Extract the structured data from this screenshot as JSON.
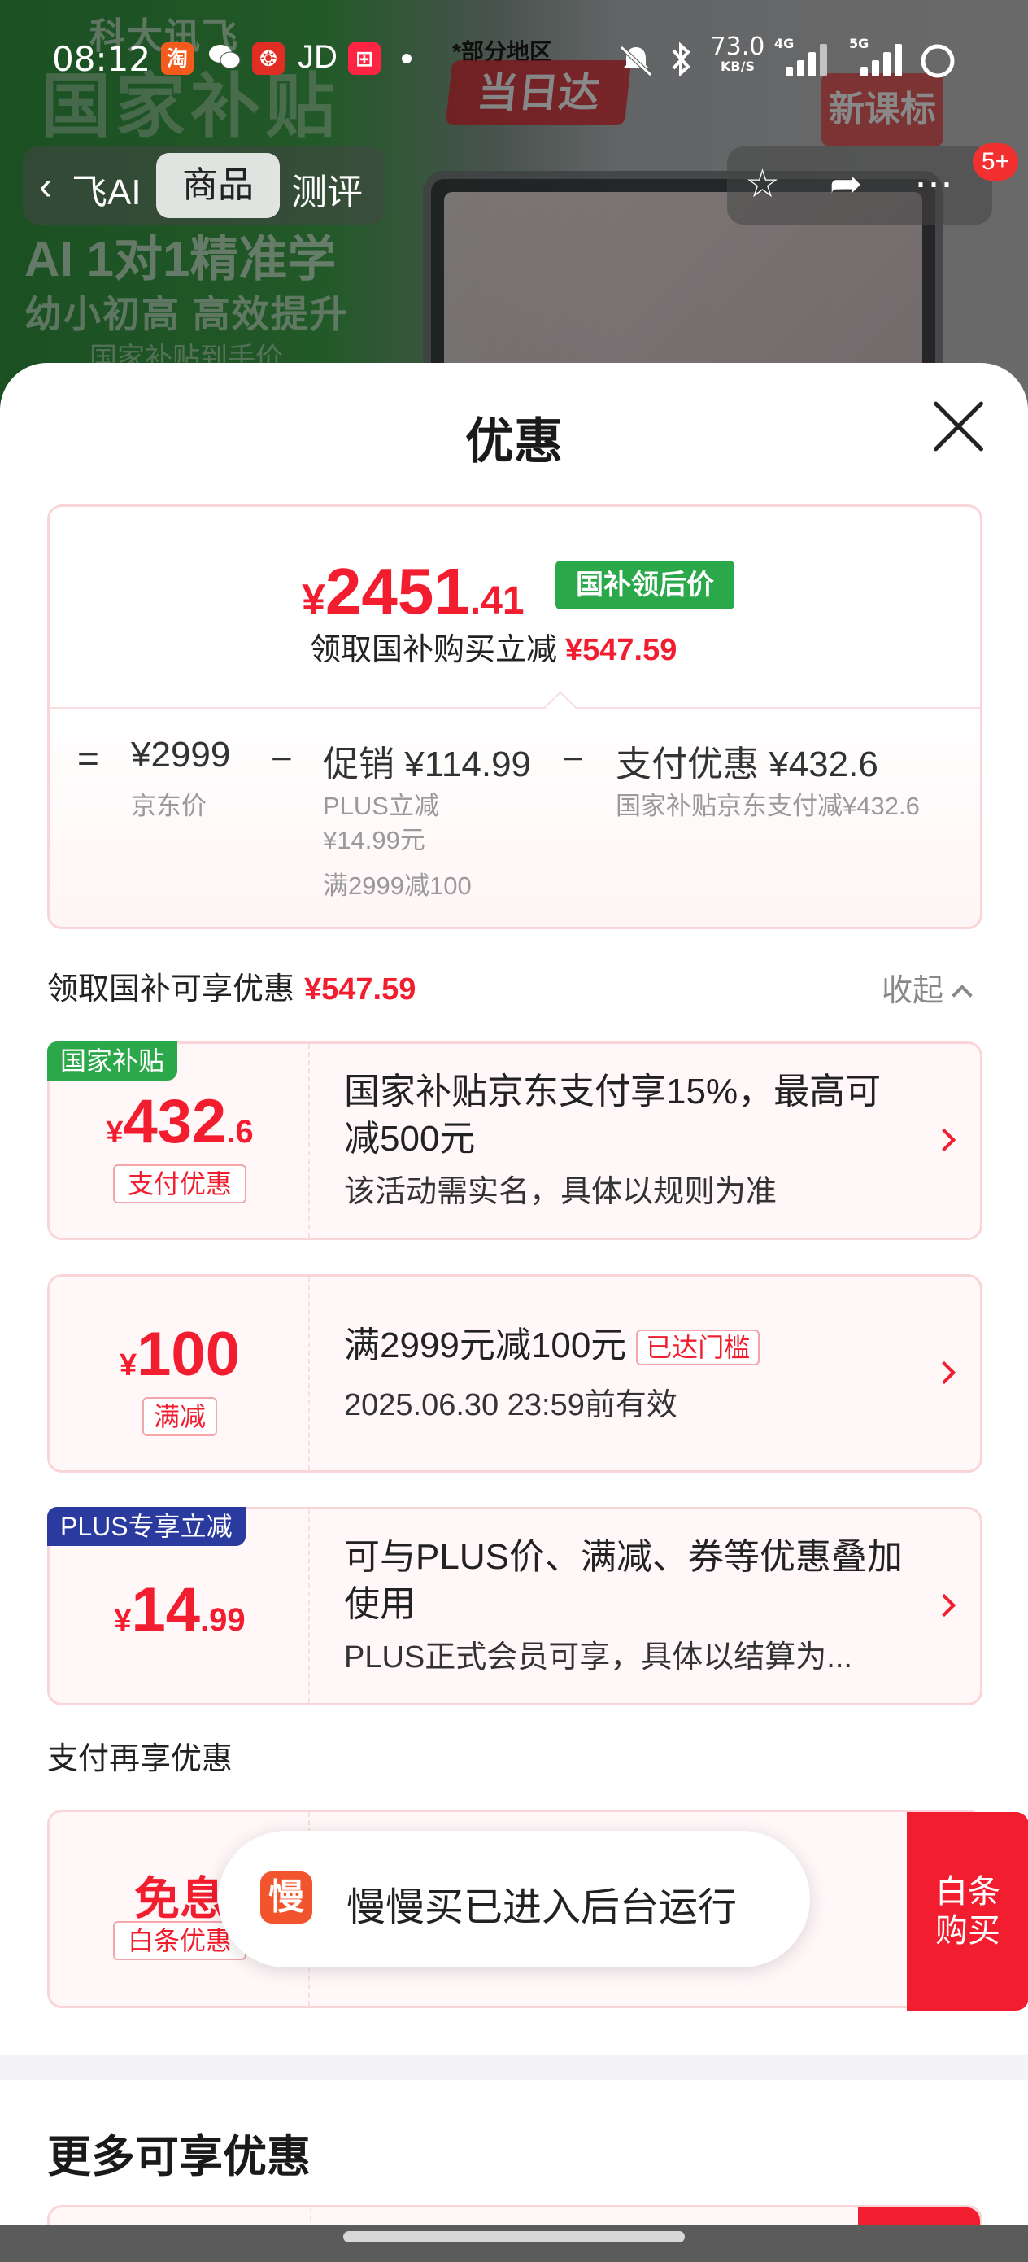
{
  "status_bar": {
    "time": "08:12",
    "jd": "JD",
    "net_speed": "73.0",
    "net_unit": "KB/S",
    "net_4g": "4G",
    "net_5g": "5G",
    "apps": [
      "taobao-icon",
      "wechat-icon",
      "pinduoduo-icon",
      "jd-text",
      "xiaohongshu-icon"
    ]
  },
  "background_page": {
    "brand": "科大讯飞",
    "headline": "国家补贴",
    "slogan_1": "AI 1对1精准学",
    "slogan_2": "幼小初高 高效提升",
    "slogan_3": "国家补贴到手价",
    "region_note": "*部分地区",
    "delivery_badge": "当日达",
    "curriculum_badge": "新课标",
    "nav_back": "‹",
    "nav_tab_left": "飞AI",
    "nav_tab_active": "商品",
    "nav_tab_review": "测评",
    "cart_count": "5+"
  },
  "sheet": {
    "title": "优惠",
    "summary": {
      "currency": "¥",
      "price_int": "2451",
      "price_dec": ".41",
      "price_tag": "国补领后价",
      "sub_label": "领取国补购买立减",
      "sub_amount": "¥547.59",
      "equals": "=",
      "minus": "−",
      "jd_price": "¥2999",
      "jd_price_label": "京东价",
      "promo": "促销 ¥114.99",
      "promo_line1": "PLUS立减",
      "promo_line2": "¥14.99元",
      "promo_line3": "满2999减100",
      "pay_discount": "支付优惠 ¥432.6",
      "pay_discount_label": "国家补贴京东支付减¥432.6"
    },
    "subsidy_section": {
      "label": "领取国补可享优惠",
      "amount": "¥547.59",
      "collapse": "收起"
    },
    "coupons": [
      {
        "corner_tag": "国家补贴",
        "currency": "¥",
        "int": "432",
        "dec": ".6",
        "pill": "支付优惠",
        "title": "国家补贴京东支付享15%，最高可减500元",
        "desc": "该活动需实名，具体以规则为准"
      },
      {
        "currency": "¥",
        "int": "100",
        "dec": "",
        "pill": "满减",
        "title": "满2999元减100元",
        "badge": "已达门槛",
        "desc": "2025.06.30 23:59前有效"
      },
      {
        "corner_tag": "PLUS专享立减",
        "currency": "¥",
        "int": "14",
        "dec": ".99",
        "title": "可与PLUS价、满减、券等优惠叠加使用",
        "desc": "PLUS正式会员可享，具体以结算为..."
      }
    ],
    "payment_section": {
      "label": "支付再享优惠",
      "card": {
        "amount": "免息",
        "pill": "白条优惠",
        "button_line1": "白条",
        "button_line2": "购买"
      }
    },
    "more_title": "更多可享优惠"
  },
  "toast": {
    "icon_char": "慢",
    "text": "慢慢买已进入后台运行"
  },
  "colors": {
    "price_red": "#f21d2e",
    "subsidy_green": "#2aa84a",
    "plus_blue": "#2b3a9e",
    "card_border": "#fad5d7"
  }
}
